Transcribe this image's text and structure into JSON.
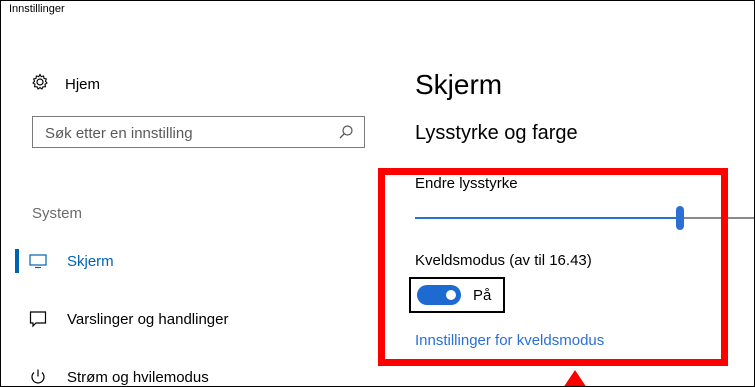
{
  "window": {
    "title": "Innstillinger"
  },
  "sidebar": {
    "home_label": "Hjem",
    "search_placeholder": "Søk etter en innstilling",
    "section_label": "System",
    "items": [
      {
        "label": "Skjerm",
        "icon": "monitor-icon",
        "active": true
      },
      {
        "label": "Varslinger og handlinger",
        "icon": "message-icon",
        "active": false
      },
      {
        "label": "Strøm og hvilemodus",
        "icon": "power-icon",
        "active": false
      }
    ]
  },
  "main": {
    "title": "Skjerm",
    "subtitle": "Lysstyrke og farge",
    "brightness_label": "Endre lysstyrke",
    "brightness_value": 78,
    "night_mode_label": "Kveldsmodus (av til 16.43)",
    "night_mode_toggle_text": "På",
    "night_mode_on": true,
    "night_mode_link": "Innstillinger for kveldsmodus"
  },
  "colors": {
    "accent": "#0063b1",
    "link": "#2a6fd6",
    "annotation": "#ff0000"
  }
}
